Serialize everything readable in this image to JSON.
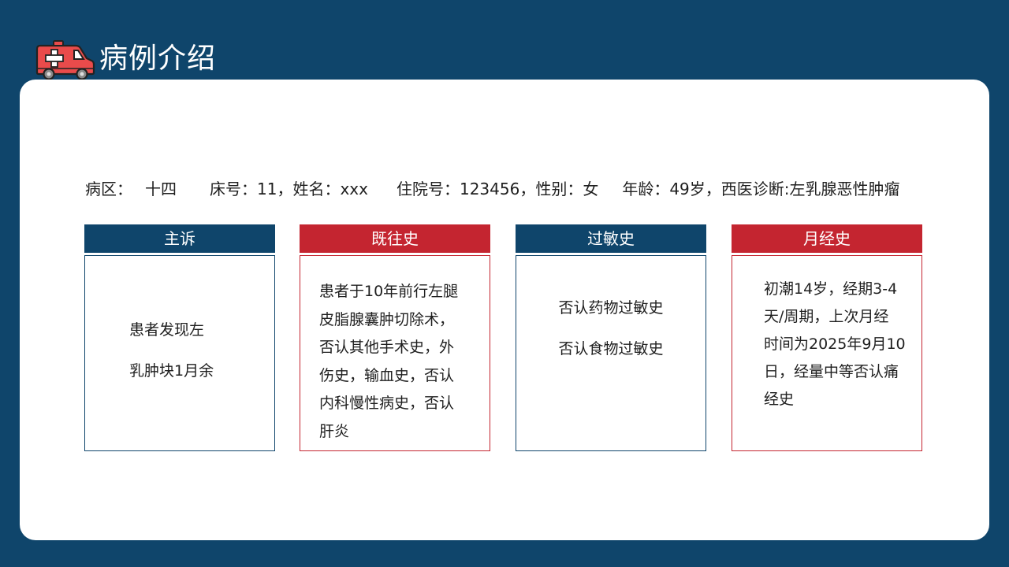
{
  "header": {
    "title": "病例介绍",
    "icon": "ambulance-icon"
  },
  "patient_info": {
    "ward_label": "病区：",
    "ward_value": "十四",
    "bed": "床号：11，姓名：xxx",
    "admission": "住院号：123456，性别：女",
    "age_diagnosis": "年龄：49岁，西医诊断:左乳腺恶性肿瘤"
  },
  "cards": [
    {
      "title": "主诉",
      "lines": [
        "患者发现左",
        "乳肿块1月余"
      ]
    },
    {
      "title": "既往史",
      "lines": [
        "患者于10年前行左腿",
        "皮脂腺囊肿切除术，",
        "否认其他手术史，外",
        "伤史，输血史，否认",
        "内科慢性病史，否认",
        "肝炎"
      ]
    },
    {
      "title": "过敏史",
      "lines": [
        "否认药物过敏史",
        "否认食物过敏史"
      ]
    },
    {
      "title": "月经史",
      "lines": [
        "初潮14岁，经期3-4",
        "天/周期，上次月经",
        "时间为2025年9月10",
        "日，经量中等否认痛",
        "经史"
      ]
    }
  ],
  "colors": {
    "background": "#0f456b",
    "accent_red": "#c42530",
    "panel": "#ffffff"
  }
}
